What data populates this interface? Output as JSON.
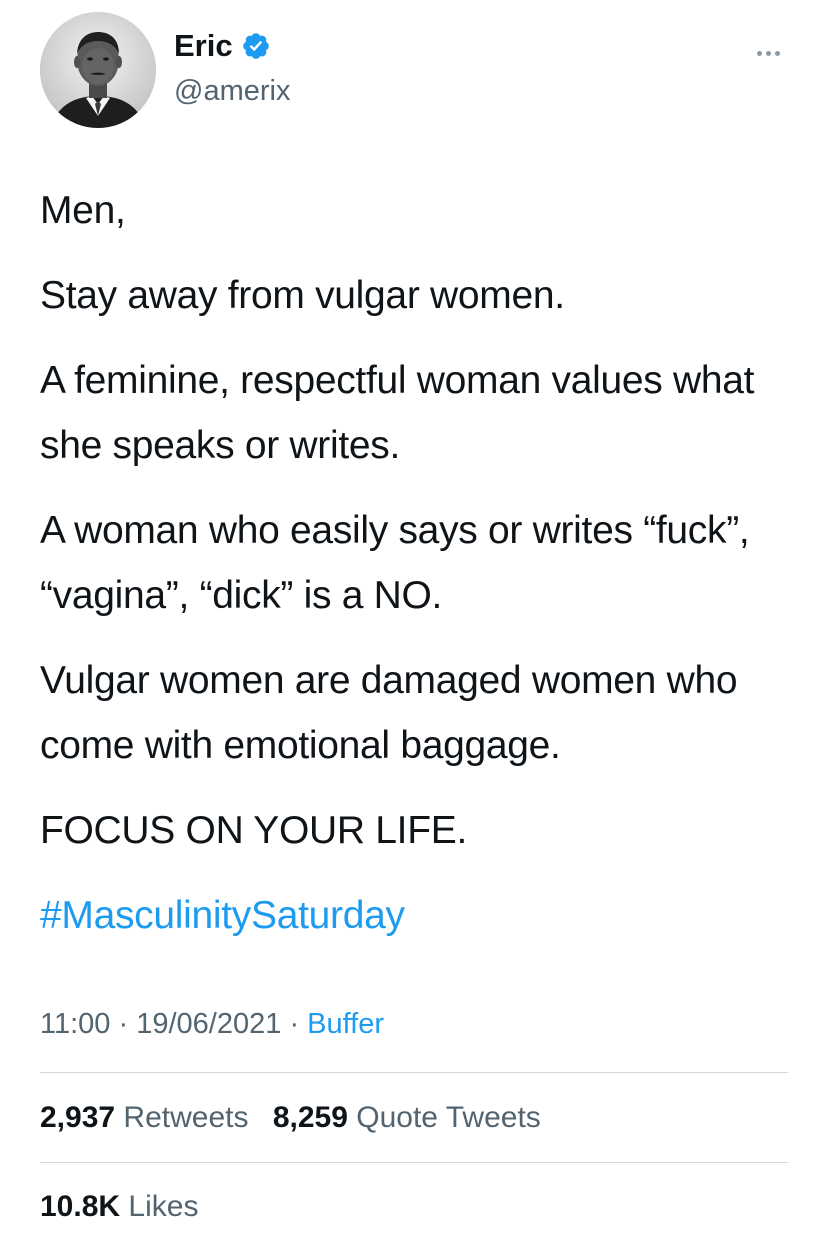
{
  "author": {
    "display_name": "Eric",
    "handle": "@amerix",
    "verified": true,
    "avatar_description": "black-and-white portrait photo"
  },
  "more_menu_icon": "more-horizontal-icon",
  "tweet": {
    "paragraphs": [
      "Men,",
      "Stay away from vulgar women.",
      "A feminine, respectful woman values what she speaks or writes.",
      "A woman who easily says or writes “fuck”, “vagina”, “dick” is a NO.",
      "Vulgar women are damaged women who come with emotional baggage.",
      "FOCUS ON YOUR LIFE."
    ],
    "hashtag": "#MasculinitySaturday"
  },
  "meta": {
    "time": "11:00",
    "separator": "·",
    "date": "19/06/2021",
    "source": "Buffer"
  },
  "stats": {
    "retweets_count": "2,937",
    "retweets_label": "Retweets",
    "quotes_count": "8,259",
    "quotes_label": "Quote Tweets",
    "likes_count": "10.8K",
    "likes_label": "Likes"
  },
  "colors": {
    "accent": "#1d9bf0",
    "text": "#0f1419",
    "secondary_text": "#536471",
    "divider": "#cfd9de"
  }
}
